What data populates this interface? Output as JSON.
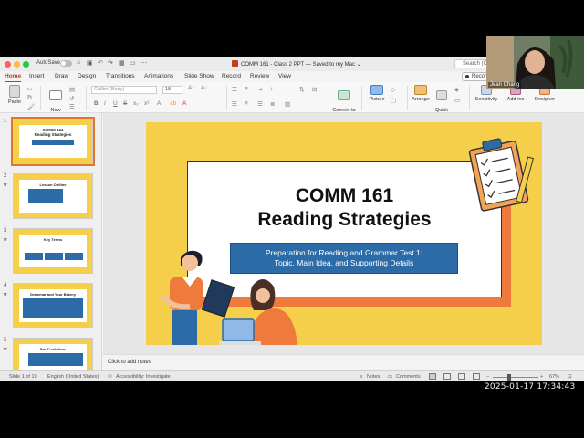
{
  "window": {
    "autosave_label": "AutoSave",
    "doc_title": "COMM 161 - Class 2 PPT",
    "saved_status": "— Saved to my Mac ",
    "search_placeholder": "Search (C"
  },
  "tabs": [
    "Home",
    "Insert",
    "Draw",
    "Design",
    "Transitions",
    "Animations",
    "Slide Show",
    "Record",
    "Review",
    "View"
  ],
  "record_button": "Record",
  "ribbon": {
    "paste": "Paste",
    "new_slide": "New\nSlide",
    "font_name": "Calibri (Body)",
    "font_size": "18",
    "convert_smartart": "Convert to\nSmartArt",
    "picture": "Picture",
    "arrange": "Arrange",
    "quick_styles": "Quick\nStyles",
    "sensitivity": "Sensitivity",
    "addins": "Add-ins",
    "designer": "Designer"
  },
  "slides": [
    {
      "num": "1",
      "title": "COMM 161\nReading Strategies"
    },
    {
      "num": "2",
      "title": "Lesson Outline"
    },
    {
      "num": "3",
      "title": "Key Terms"
    },
    {
      "num": "4",
      "title": "Grammar and Your Bakery"
    },
    {
      "num": "5",
      "title": "Our Prediction:"
    }
  ],
  "main_slide": {
    "title_line1": "COMM 161",
    "title_line2": "Reading Strategies",
    "subtitle_line1": "Preparation for Reading and Grammar Test 1:",
    "subtitle_line2": "Topic, Main Idea, and Supporting Details"
  },
  "notes_placeholder": "Click to add notes",
  "status": {
    "slide_of": "Slide 1 of 19",
    "language": "English (United States)",
    "accessibility": "Accessibility: Investigate",
    "notes": "Notes",
    "comments": "Comments",
    "zoom": "67%"
  },
  "webcam": {
    "name": "Jean Chang"
  },
  "timestamp": "2025-01-17  17:34:43",
  "colors": {
    "accent": "#c43e1c",
    "slide_yellow": "#f5cf4a",
    "slide_orange": "#ee7a3b",
    "slide_blue": "#2a6ba8"
  }
}
